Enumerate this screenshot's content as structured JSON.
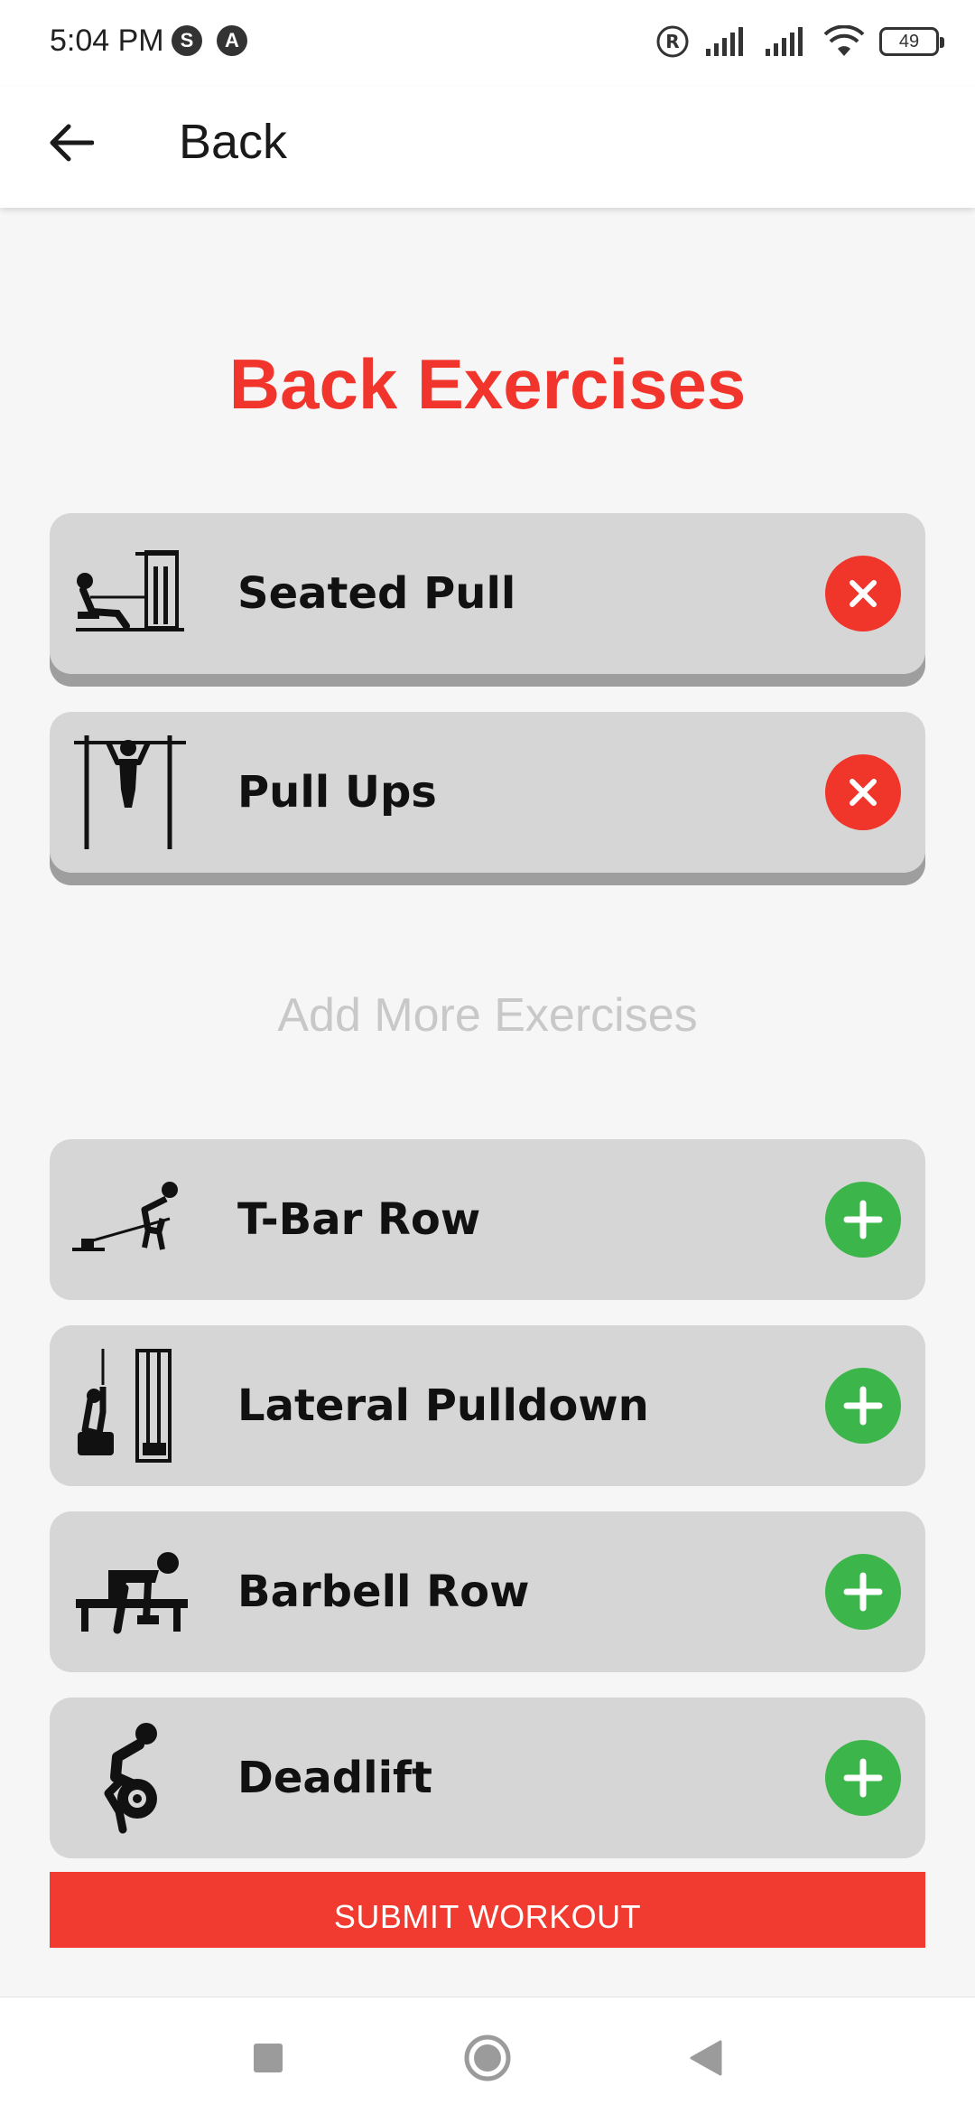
{
  "status_bar": {
    "time": "5:04 PM",
    "app_icons": [
      "S",
      "A"
    ],
    "battery": "49"
  },
  "app_bar": {
    "back_icon": "arrow-left-icon",
    "title": "Back"
  },
  "page": {
    "title": "Back Exercises",
    "title_color": "#f2352c",
    "add_more_label": "Add More Exercises",
    "submit_label": "SUBMIT WORKOUT"
  },
  "selected_exercises": [
    {
      "name": "Seated Pull",
      "icon": "seated-row-machine-icon",
      "action": "remove"
    },
    {
      "name": "Pull Ups",
      "icon": "pull-up-bar-icon",
      "action": "remove"
    }
  ],
  "available_exercises": [
    {
      "name": "T-Bar Row",
      "icon": "t-bar-row-icon",
      "action": "add"
    },
    {
      "name": "Lateral Pulldown",
      "icon": "lat-pulldown-machine-icon",
      "action": "add"
    },
    {
      "name": "Barbell Row",
      "icon": "dumbbell-row-bench-icon",
      "action": "add"
    },
    {
      "name": "Deadlift",
      "icon": "deadlift-icon",
      "action": "add"
    }
  ],
  "colors": {
    "remove": "#f0352b",
    "add": "#3cb54a",
    "submit": "#f13a30",
    "card": "#d6d6d6"
  }
}
